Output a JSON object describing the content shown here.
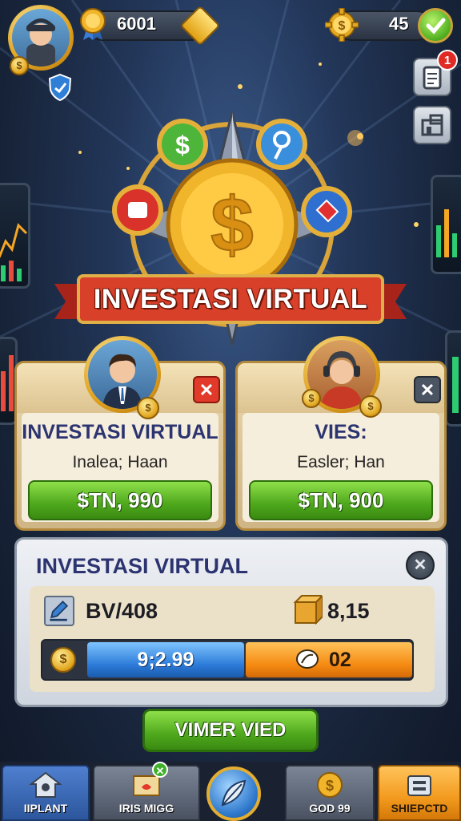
{
  "hud": {
    "currency_left": "6001",
    "currency_right": "45",
    "notification_count": "1"
  },
  "title_banner": "INVESTASI VIRTUAL",
  "cards": [
    {
      "title": "INVESTASI VIRTUAL",
      "subtitle": "Inalea; Haan",
      "button": "$TN, 990"
    },
    {
      "title": "VIES:",
      "subtitle": "Easler; Han",
      "button": "$TN, 900"
    }
  ],
  "panel": {
    "title": "INVESTASI VIRTUAL",
    "stat_left": "BV/408",
    "stat_right": "8,15",
    "bar_blue": "9;2.99",
    "bar_orange": "02"
  },
  "action_button": "VIMER VIED",
  "tabs": [
    {
      "label": "IIPLANT",
      "icon": "home-icon"
    },
    {
      "label": "IRIS MIGG",
      "icon": "map-icon"
    },
    {
      "label": "",
      "icon": "feather-orb-icon"
    },
    {
      "label": "GOD 99",
      "icon": "coin-icon"
    },
    {
      "label": "SHIEPCTD",
      "icon": "shop-icon"
    }
  ],
  "colors": {
    "accent_green": "#4ea81c",
    "banner_red": "#c8321a",
    "gold": "#e0a21e",
    "active_tab": "#f29a1e"
  }
}
